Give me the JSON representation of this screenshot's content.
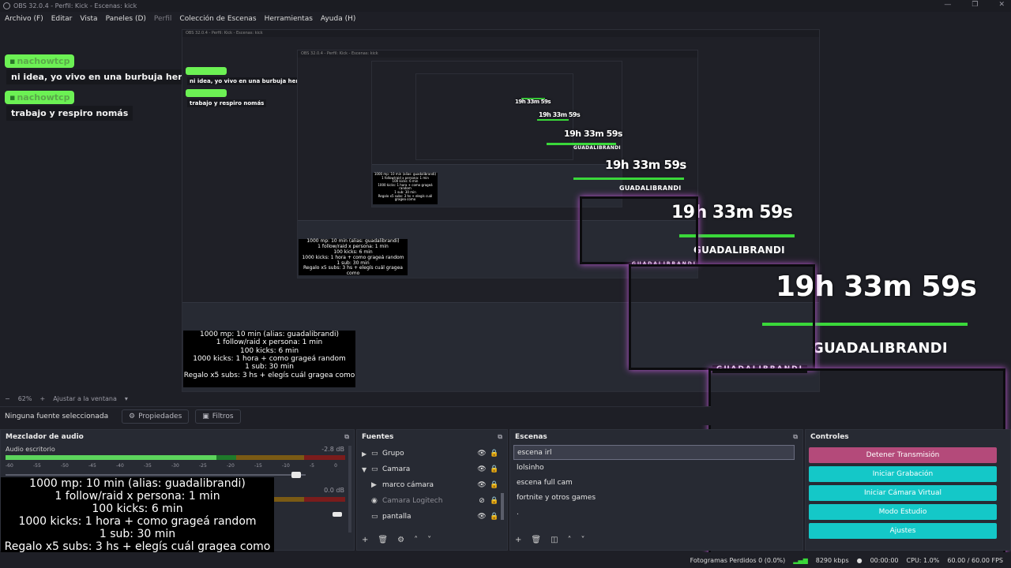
{
  "window": {
    "title": "OBS 32.0.4 - Perfil: Kick - Escenas: kick",
    "controls": [
      "—",
      "❐",
      "✕"
    ]
  },
  "menu": [
    {
      "label": "Archivo (F)",
      "dim": false
    },
    {
      "label": "Editar",
      "dim": false
    },
    {
      "label": "Vista",
      "dim": false
    },
    {
      "label": "Paneles (D)",
      "dim": false
    },
    {
      "label": "Perfil",
      "dim": true
    },
    {
      "label": "Colección de Escenas",
      "dim": false
    },
    {
      "label": "Herramientas",
      "dim": false
    },
    {
      "label": "Ayuda (H)",
      "dim": false
    }
  ],
  "chat": [
    {
      "user": "nachowtcp",
      "message": "ni idea, yo vivo en una burbuja hermano"
    },
    {
      "user": "nachowtcp",
      "message": "trabajo y respiro nomás"
    }
  ],
  "overlay": {
    "timer": "19h 33m 59s",
    "streamer": "GUADALIBRANDI",
    "cam_label": "GUADALIBRANDI"
  },
  "goals": [
    "1000 mp: 10 min (alias: guadalibrandi)",
    "1 follow/raid x persona: 1 min",
    "100 kicks: 6 min",
    "1000 kicks: 1 hora + como grageá random",
    "1 sub: 30 min",
    "Regalo x5 subs: 3 hs + elegís cuál gragea como"
  ],
  "zoom": {
    "value": "62%",
    "fit": "Ajustar a la ventana"
  },
  "source_bar": {
    "no_selection": "Ninguna fuente seleccionada",
    "properties": "Propiedades",
    "filters": "Filtros"
  },
  "mixer": {
    "title": "Mezclador de audio",
    "tracks": [
      {
        "name": "Audio escritorio",
        "db": "-2.8 dB",
        "level": 0.62
      },
      {
        "name": "",
        "db": "0.0 dB",
        "level": 0.0
      }
    ],
    "ticks": [
      "-60",
      "-55",
      "-50",
      "-45",
      "-40",
      "-35",
      "-30",
      "-25",
      "-20",
      "-15",
      "-10",
      "-5",
      "0"
    ]
  },
  "sources": {
    "title": "Fuentes",
    "items": [
      {
        "name": "Grupo",
        "icon": "folder-icon",
        "tri": "▶",
        "dim": false,
        "eye": "👁",
        "lock": "🔒"
      },
      {
        "name": "Camara",
        "icon": "folder-icon",
        "tri": "▼",
        "dim": false,
        "eye": "👁",
        "lock": "🔒"
      },
      {
        "name": "marco cámara",
        "icon": "play-icon",
        "tri": "",
        "dim": false,
        "eye": "👁",
        "lock": "🔒"
      },
      {
        "name": "Camara Logitech",
        "icon": "camera-icon",
        "tri": "",
        "dim": true,
        "eye": "⊘",
        "lock": "🔒"
      },
      {
        "name": "pantalla",
        "icon": "monitor-icon",
        "tri": "",
        "dim": false,
        "eye": "👁",
        "lock": "🔒"
      }
    ]
  },
  "scenes": {
    "title": "Escenas",
    "items": [
      {
        "name": "escena irl",
        "selected": true
      },
      {
        "name": "lolsinho",
        "selected": false
      },
      {
        "name": "escena full cam",
        "selected": false
      },
      {
        "name": "fortnite y otros games",
        "selected": false
      },
      {
        "name": ".",
        "selected": false
      }
    ]
  },
  "controls": {
    "title": "Controles",
    "buttons": [
      {
        "label": "Detener Transmisión",
        "kind": "stop"
      },
      {
        "label": "Iniciar Grabación",
        "kind": "normal"
      },
      {
        "label": "Iniciar Cámara Virtual",
        "kind": "normal"
      },
      {
        "label": "Modo Estudio",
        "kind": "normal"
      },
      {
        "label": "Ajustes",
        "kind": "normal"
      }
    ]
  },
  "status": {
    "dropped": "Fotogramas Perdidos 0 (0.0%)",
    "bitrate": "8290 kbps",
    "time": "00:00:00",
    "cpu": "CPU: 1.0%",
    "fps": "60.00 / 60.00 FPS"
  },
  "colors": {
    "accent_cyan": "#14c8c8",
    "stop_pink": "#b44a7a",
    "chat_green": "#6cf154",
    "meter_green": "#3ad83a"
  }
}
